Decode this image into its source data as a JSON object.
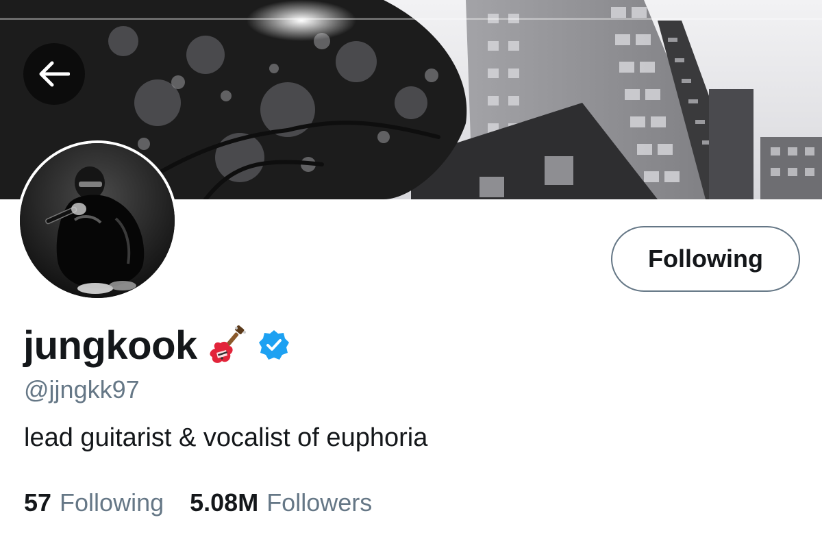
{
  "header": {
    "back_icon": "arrow-left-icon",
    "banner_description_colors": {
      "sky": "#e9e9ec",
      "building": "#8c8c90",
      "foliage": "#1e1e1e"
    }
  },
  "profile": {
    "display_name": "jungkook",
    "name_emoji_icon": "guitar-icon",
    "verified_icon": "verified-badge-icon",
    "handle": "@jjngkk97",
    "bio": "lead guitarist & vocalist of euphoria",
    "follow_button_label": "Following"
  },
  "stats": {
    "following_count": "57",
    "following_label": "Following",
    "followers_count": "5.08M",
    "followers_label": "Followers"
  },
  "colors": {
    "text_primary": "#14171a",
    "text_secondary": "#657786",
    "verified_blue": "#1da1f2",
    "button_border": "#657786"
  }
}
